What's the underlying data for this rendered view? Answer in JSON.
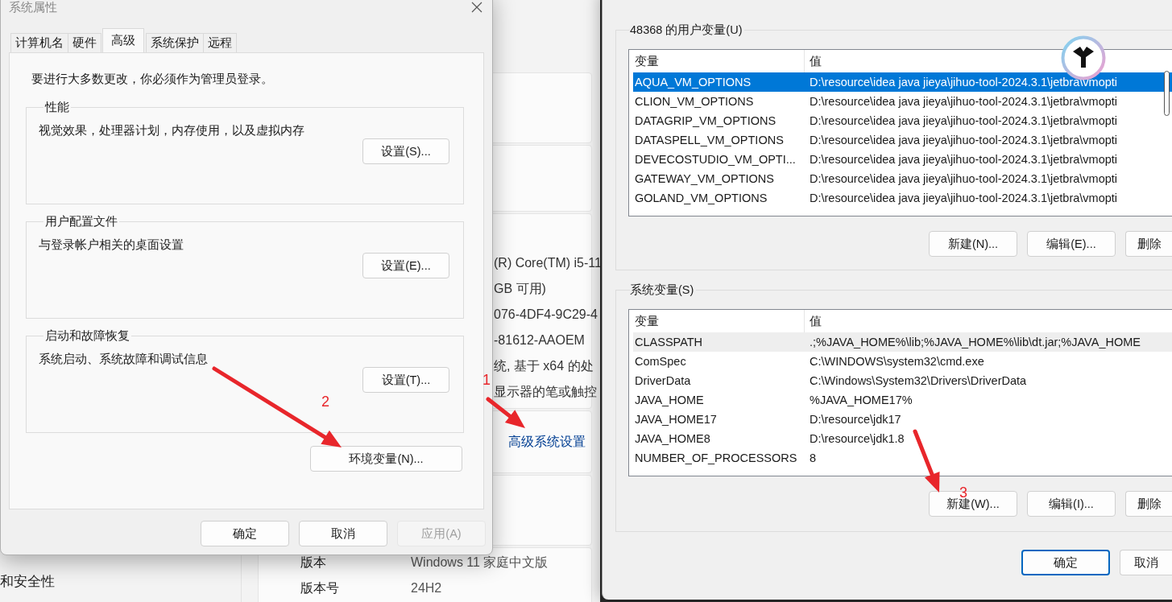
{
  "background_window": {
    "sidebar_items": [
      "和安全性"
    ],
    "device_specs": [
      "(R) Core(TM) i5-11",
      "GB 可用)",
      "076-4DF4-9C29-4",
      "-81612-AAOEM",
      "统, 基于 x64 的处",
      "显示器的笔或触控"
    ],
    "related_link": "高级系统设置",
    "windows_specs": [
      {
        "label": "版本",
        "value": "Windows 11 家庭中文版"
      },
      {
        "label": "版本号",
        "value": "24H2"
      }
    ]
  },
  "system_properties": {
    "title": "系统属性",
    "tabs": [
      {
        "label": "计算机名",
        "selected": false
      },
      {
        "label": "硬件",
        "selected": false
      },
      {
        "label": "高级",
        "selected": true
      },
      {
        "label": "系统保护",
        "selected": false
      },
      {
        "label": "远程",
        "selected": false
      }
    ],
    "admin_note": "要进行大多数更改，你必须作为管理员登录。",
    "groups": [
      {
        "title": "性能",
        "description": "视觉效果，处理器计划，内存使用，以及虚拟内存",
        "button": "设置(S)..."
      },
      {
        "title": "用户配置文件",
        "description": "与登录帐户相关的桌面设置",
        "button": "设置(E)..."
      },
      {
        "title": "启动和故障恢复",
        "description": "系统启动、系统故障和调试信息",
        "button": "设置(T)..."
      }
    ],
    "env_button": "环境变量(N)...",
    "footer_buttons": [
      {
        "label": "确定",
        "disabled": false
      },
      {
        "label": "取消",
        "disabled": false
      },
      {
        "label": "应用(A)",
        "disabled": true
      }
    ]
  },
  "environment_variables": {
    "sections": [
      {
        "title": "48368 的用户变量(U)",
        "focused": true,
        "columns": [
          "变量",
          "值"
        ],
        "rows": [
          {
            "name": "AQUA_VM_OPTIONS",
            "value": "D:\\resource\\idea java jieya\\jihuo-tool-2024.3.1\\jetbra\\vmopti",
            "selected": true
          },
          {
            "name": "CLION_VM_OPTIONS",
            "value": "D:\\resource\\idea java jieya\\jihuo-tool-2024.3.1\\jetbra\\vmopti",
            "selected": false
          },
          {
            "name": "DATAGRIP_VM_OPTIONS",
            "value": "D:\\resource\\idea java jieya\\jihuo-tool-2024.3.1\\jetbra\\vmopti",
            "selected": false
          },
          {
            "name": "DATASPELL_VM_OPTIONS",
            "value": "D:\\resource\\idea java jieya\\jihuo-tool-2024.3.1\\jetbra\\vmopti",
            "selected": false
          },
          {
            "name": "DEVECOSTUDIO_VM_OPTI...",
            "value": "D:\\resource\\idea java jieya\\jihuo-tool-2024.3.1\\jetbra\\vmopti",
            "selected": false
          },
          {
            "name": "GATEWAY_VM_OPTIONS",
            "value": "D:\\resource\\idea java jieya\\jihuo-tool-2024.3.1\\jetbra\\vmopti",
            "selected": false
          },
          {
            "name": "GOLAND_VM_OPTIONS",
            "value": "D:\\resource\\idea java jieya\\jihuo-tool-2024.3.1\\jetbra\\vmopti",
            "selected": false
          }
        ],
        "buttons": [
          "新建(N)...",
          "编辑(E)...",
          "删除"
        ]
      },
      {
        "title": "系统变量(S)",
        "focused": false,
        "columns": [
          "变量",
          "值"
        ],
        "rows": [
          {
            "name": "CLASSPATH",
            "value": ".;%JAVA_HOME%\\lib;%JAVA_HOME%\\lib\\dt.jar;%JAVA_HOME",
            "selected": true
          },
          {
            "name": "ComSpec",
            "value": "C:\\WINDOWS\\system32\\cmd.exe",
            "selected": false
          },
          {
            "name": "DriverData",
            "value": "C:\\Windows\\System32\\Drivers\\DriverData",
            "selected": false
          },
          {
            "name": "JAVA_HOME",
            "value": "%JAVA_HOME17%",
            "selected": false
          },
          {
            "name": "JAVA_HOME17",
            "value": "D:\\resource\\jdk17",
            "selected": false
          },
          {
            "name": "JAVA_HOME8",
            "value": "D:\\resource\\jdk1.8",
            "selected": false
          },
          {
            "name": "NUMBER_OF_PROCESSORS",
            "value": "8",
            "selected": false
          }
        ],
        "buttons": [
          "新建(W)...",
          "编辑(I)...",
          "删除"
        ]
      }
    ],
    "footer_buttons": [
      {
        "label": "确定",
        "is_default": true
      },
      {
        "label": "取消",
        "is_default": false
      }
    ]
  },
  "annotations": [
    {
      "label": "1"
    },
    {
      "label": "2"
    },
    {
      "label": "3"
    }
  ]
}
